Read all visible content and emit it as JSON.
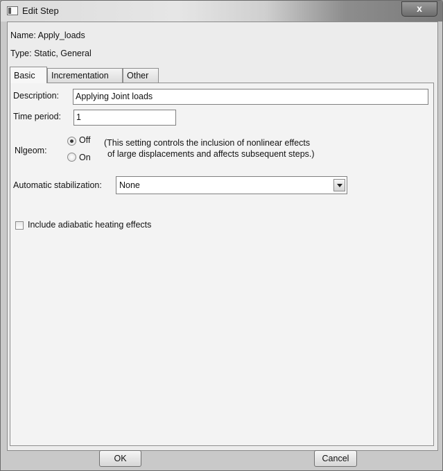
{
  "window": {
    "title": "Edit Step",
    "close_symbol": "x"
  },
  "step": {
    "name_label": "Name:",
    "name_value": "Apply_loads",
    "type_label": "Type:",
    "type_value": "Static, General"
  },
  "tabs": [
    {
      "label": "Basic",
      "active": true
    },
    {
      "label": "Incrementation",
      "active": false
    },
    {
      "label": "Other",
      "active": false
    }
  ],
  "basic": {
    "description_label": "Description:",
    "description_value": "Applying Joint loads",
    "time_period_label": "Time period:",
    "time_period_value": "1",
    "nlgeom_label": "Nlgeom:",
    "nlgeom_options": [
      {
        "label": "Off",
        "selected": true
      },
      {
        "label": "On",
        "selected": false
      }
    ],
    "nlgeom_note_line1": "(This setting controls the inclusion of nonlinear effects",
    "nlgeom_note_line2": "of large displacements and affects subsequent steps.)",
    "stabilization_label": "Automatic stabilization:",
    "stabilization_value": "None",
    "adiabatic_label": "Include adiabatic heating effects",
    "adiabatic_checked": false
  },
  "buttons": {
    "ok": "OK",
    "cancel": "Cancel"
  }
}
